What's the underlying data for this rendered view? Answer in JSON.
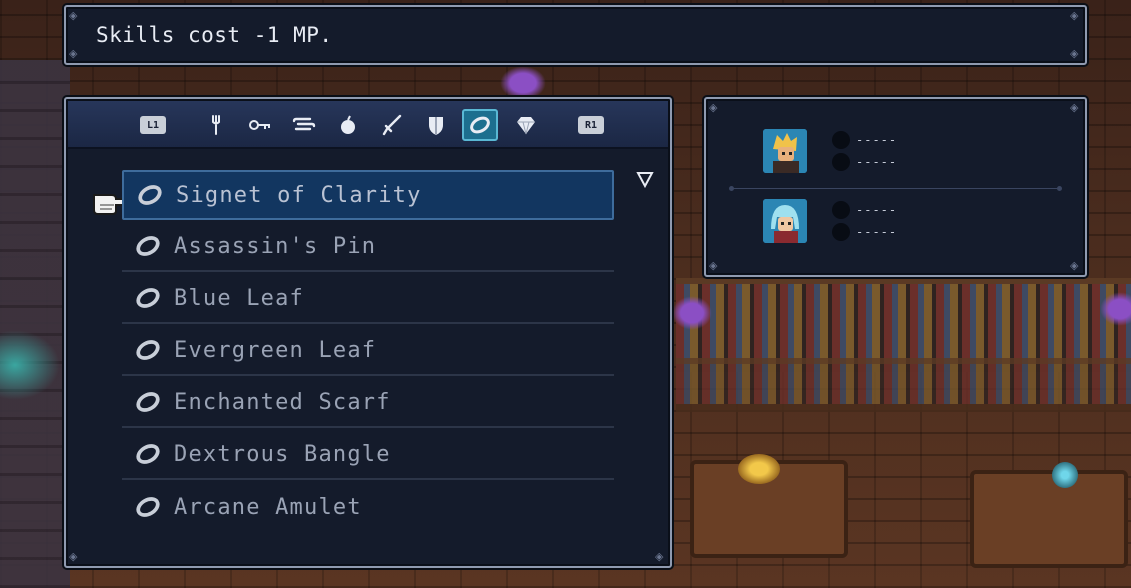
{
  "description": {
    "text": "Skills cost -1 MP."
  },
  "inventory": {
    "shoulder_left": "L1",
    "shoulder_right": "R1",
    "tabs": [
      {
        "icon": "fork-icon",
        "label": "Meals"
      },
      {
        "icon": "key-icon",
        "label": "Key items"
      },
      {
        "icon": "scroll-icon",
        "label": "Scrolls"
      },
      {
        "icon": "apple-icon",
        "label": "Ingredients"
      },
      {
        "icon": "sword-icon",
        "label": "Weapons"
      },
      {
        "icon": "shield-icon",
        "label": "Armor"
      },
      {
        "icon": "ring-icon",
        "label": "Accessories",
        "active": true
      },
      {
        "icon": "gem-icon",
        "label": "Valuables"
      }
    ],
    "items": [
      "Signet of Clarity",
      "Assassin's Pin",
      "Blue Leaf",
      "Evergreen Leaf",
      "Enchanted Scarf",
      "Dextrous Bangle",
      "Arcane Amulet"
    ],
    "selected_index": 0
  },
  "party": {
    "members": [
      {
        "portrait": "blonde-warrior-portrait",
        "slots": [
          "-----",
          "-----"
        ]
      },
      {
        "portrait": "blue-haired-mage-portrait",
        "slots": [
          "-----",
          "-----"
        ]
      }
    ]
  },
  "colors": {
    "panel_bg": "#141b2b",
    "selection": "#123660",
    "active_tab": "#1d6f8f",
    "text": "#e8ecf4"
  }
}
